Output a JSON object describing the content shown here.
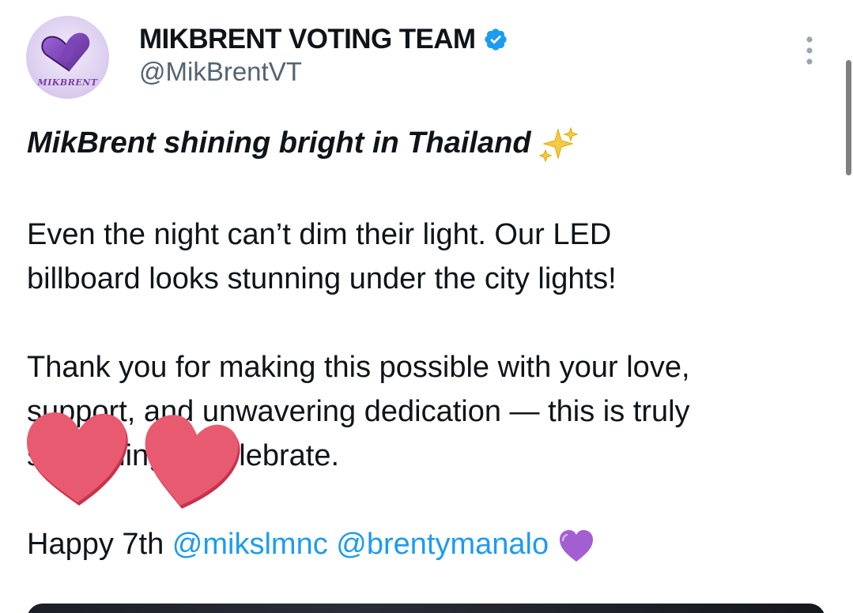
{
  "author": {
    "avatar_text": "MIKBRENT",
    "display_name": "MIKBRENT VOTING TEAM",
    "handle": "@MikBrentVT",
    "verified": true,
    "verified_color": "#1d9bf0"
  },
  "tweet": {
    "headline": "MikBrent shining bright in Thailand",
    "headline_emoji": "sparkles",
    "para1_line1": "Even the night can’t dim their light. Our LED",
    "para1_line2": "billboard looks stunning under the city lights!",
    "para2_line1": "Thank you for making this possible with your love,",
    "para2_line2": "support, and unwavering dedication — this is truly",
    "para2_line3": "something to celebrate.",
    "happy_prefix": "Happy 7th",
    "mention1": "@mikslmnc",
    "mention2": "@brentymanalo",
    "closing_emoji": "purple-heart"
  },
  "colors": {
    "mention": "#1d9bf0",
    "text": "#0f1419",
    "secondary": "#536471",
    "sticker_heart": "#e85a70",
    "purple_heart": "#a35fd1"
  }
}
